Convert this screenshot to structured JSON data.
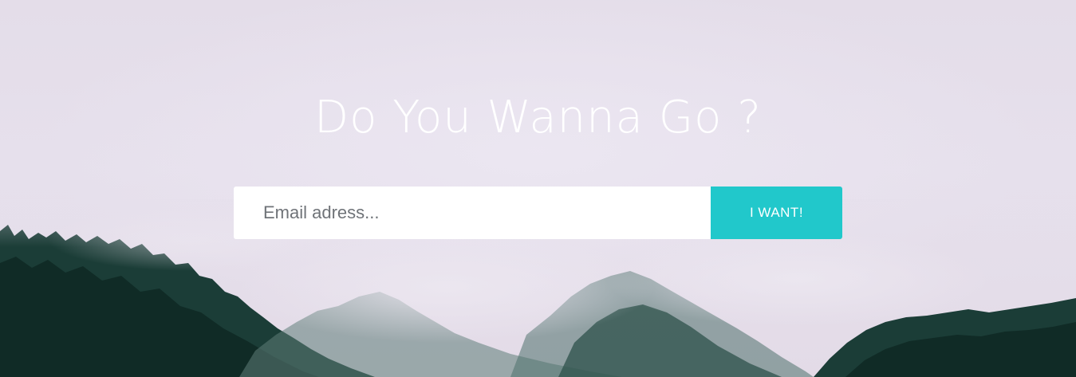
{
  "hero": {
    "headline": "Do You Wanna Go ?",
    "email_placeholder": "Email adress...",
    "submit_label": "I WANT!"
  },
  "colors": {
    "button": "#21c8cb",
    "sky": "#e6e0ec",
    "trees_dark": "#173a33"
  },
  "background": {
    "scene": "misty-forest"
  }
}
